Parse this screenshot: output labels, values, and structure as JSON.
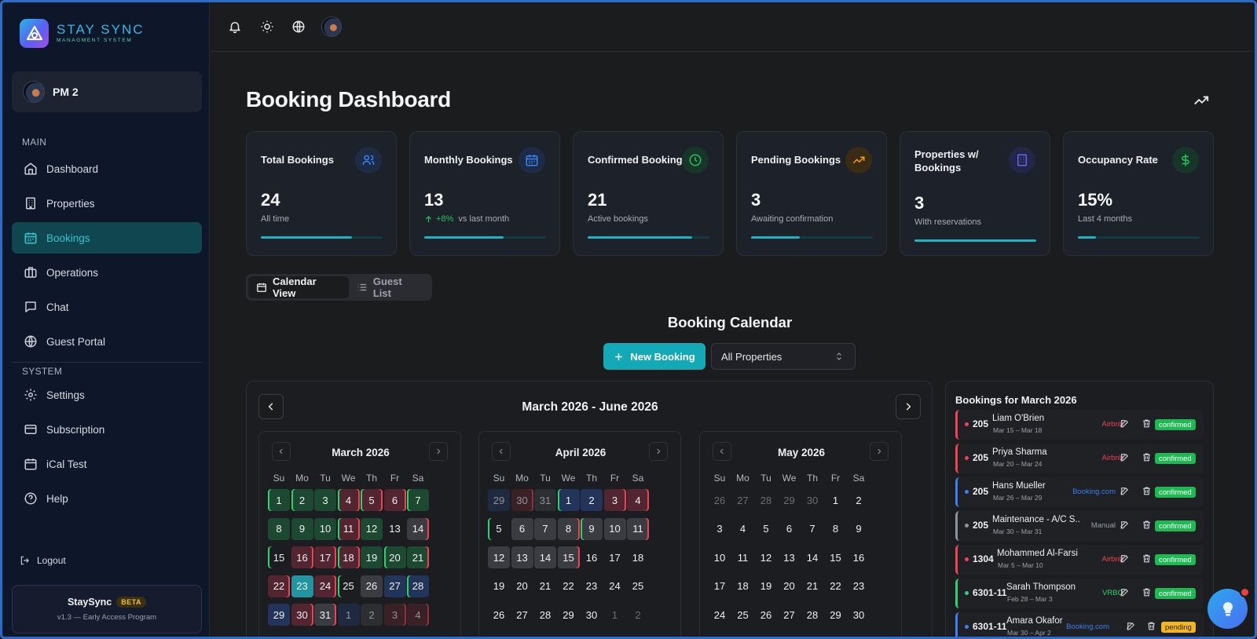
{
  "brand": {
    "title": "STAY SYNC",
    "subtitle": "MANAGMENT SYSTEM"
  },
  "user": {
    "name": "PM 2"
  },
  "sidebar": {
    "main_label": "MAIN",
    "system_label": "SYSTEM",
    "items": [
      {
        "label": "Dashboard",
        "icon": "home-icon"
      },
      {
        "label": "Properties",
        "icon": "building-icon"
      },
      {
        "label": "Bookings",
        "icon": "calendar-icon",
        "active": true
      },
      {
        "label": "Operations",
        "icon": "briefcase-icon"
      },
      {
        "label": "Chat",
        "icon": "chat-icon"
      },
      {
        "label": "Guest Portal",
        "icon": "globe-icon"
      },
      {
        "label": "Settings",
        "icon": "gear-icon"
      },
      {
        "label": "Subscription",
        "icon": "credit-card-icon"
      },
      {
        "label": "iCal Test",
        "icon": "calendar-icon"
      },
      {
        "label": "Help",
        "icon": "help-icon"
      }
    ],
    "logout": "Logout",
    "beta": {
      "name": "StaySync",
      "badge": "BETA",
      "sub": "v1.3 — Early Access Program"
    }
  },
  "page": {
    "title": "Booking Dashboard"
  },
  "stats": [
    {
      "title": "Total Bookings",
      "value": "24",
      "sub": "All time",
      "progress": 0.75,
      "icon": "users-icon",
      "accent": "#3b82f6"
    },
    {
      "title": "Monthly Bookings",
      "value": "13",
      "trend": "+8%",
      "sub": "vs last month",
      "progress": 0.65,
      "icon": "calendar-icon",
      "accent": "#3b82f6"
    },
    {
      "title": "Confirmed Bookings",
      "value": "21",
      "sub": "Active bookings",
      "progress": 0.86,
      "icon": "clock-icon",
      "accent": "#22c55e"
    },
    {
      "title": "Pending Bookings",
      "value": "3",
      "sub": "Awaiting confirmation",
      "progress": 0.4,
      "icon": "trending-up-icon",
      "accent": "#f59e0b"
    },
    {
      "title": "Properties w/ Bookings",
      "value": "3",
      "sub": "With reservations",
      "progress": 1.0,
      "icon": "building-icon",
      "accent": "#6366f1"
    },
    {
      "title": "Occupancy Rate",
      "value": "15%",
      "sub": "Last 4 months",
      "progress": 0.15,
      "icon": "dollar-icon",
      "accent": "#22c55e"
    }
  ],
  "tabs": {
    "calendar": "Calendar View",
    "guests": "Guest List"
  },
  "calendar": {
    "heading": "Booking Calendar",
    "new_booking": "New Booking",
    "property_select": "All Properties",
    "range": "March 2026 - June 2026",
    "dow": [
      "Su",
      "Mo",
      "Tu",
      "We",
      "Th",
      "Fr",
      "Sa"
    ],
    "months": [
      {
        "name": "March 2026",
        "weeks": [
          [
            "1",
            "2",
            "3",
            "4",
            "5",
            "6",
            "7"
          ],
          [
            "8",
            "9",
            "10",
            "11",
            "12",
            "13",
            "14"
          ],
          [
            "15",
            "16",
            "17",
            "18",
            "19",
            "20",
            "21"
          ],
          [
            "22",
            "23",
            "24",
            "25",
            "26",
            "27",
            "28"
          ],
          [
            "29",
            "30",
            "31",
            "1",
            "2",
            "3",
            "4"
          ]
        ],
        "styles": [
          [
            "g l",
            "g l",
            "g",
            "r l",
            "r l",
            "r r",
            "g l"
          ],
          [
            "g",
            "g",
            "g",
            "r l",
            "g",
            "x",
            "k r"
          ],
          [
            "x l",
            "r",
            "r r",
            "r l",
            "g",
            "g l",
            "g r"
          ],
          [
            "r",
            "t",
            "r r",
            "x l",
            "k",
            "b",
            "b l"
          ],
          [
            "b",
            "r",
            "k r",
            "b m",
            "k m",
            "r m",
            "r m"
          ]
        ]
      },
      {
        "name": "April 2026",
        "weeks": [
          [
            "29",
            "30",
            "31",
            "1",
            "2",
            "3",
            "4"
          ],
          [
            "5",
            "6",
            "7",
            "8",
            "9",
            "10",
            "11"
          ],
          [
            "12",
            "13",
            "14",
            "15",
            "16",
            "17",
            "18"
          ],
          [
            "19",
            "20",
            "21",
            "22",
            "23",
            "24",
            "25"
          ],
          [
            "26",
            "27",
            "28",
            "29",
            "30",
            "1",
            "2"
          ]
        ],
        "styles": [
          [
            "b m",
            "r m",
            "k m",
            "b l",
            "b",
            "r",
            "r r"
          ],
          [
            "x l",
            "k",
            "k",
            "k r",
            "k l",
            "k",
            "k r"
          ],
          [
            "k",
            "k",
            "k",
            "k r",
            "x",
            "x",
            "x"
          ],
          [
            "x",
            "x",
            "x",
            "x",
            "x",
            "x",
            "x"
          ],
          [
            "x",
            "x",
            "x",
            "x",
            "x",
            "x m",
            "x m"
          ]
        ]
      },
      {
        "name": "May 2026",
        "weeks": [
          [
            "26",
            "27",
            "28",
            "29",
            "30",
            "1",
            "2"
          ],
          [
            "3",
            "4",
            "5",
            "6",
            "7",
            "8",
            "9"
          ],
          [
            "10",
            "11",
            "12",
            "13",
            "14",
            "15",
            "16"
          ],
          [
            "17",
            "18",
            "19",
            "20",
            "21",
            "22",
            "23"
          ],
          [
            "24",
            "25",
            "26",
            "27",
            "28",
            "29",
            "30"
          ]
        ],
        "styles": [
          [
            "x m",
            "x m",
            "x m",
            "x m",
            "x m",
            "x",
            "x"
          ],
          [
            "x",
            "x",
            "x",
            "x",
            "x",
            "x",
            "x"
          ],
          [
            "x",
            "x",
            "x",
            "x",
            "x",
            "x",
            "x"
          ],
          [
            "x",
            "x",
            "x",
            "x",
            "x",
            "x",
            "x"
          ],
          [
            "x",
            "x",
            "x",
            "x",
            "x",
            "x",
            "x"
          ]
        ]
      }
    ]
  },
  "bookings": {
    "title": "Bookings for March 2026",
    "items": [
      {
        "unit": "205",
        "name": "Liam O'Brien",
        "dates": "Mar 15 – Mar 18",
        "source": "Airbnb",
        "status": "confirmed",
        "color": "#ef4255",
        "src_color": "#ef4255"
      },
      {
        "unit": "205",
        "name": "Priya Sharma",
        "dates": "Mar 20 – Mar 24",
        "source": "Airbnb",
        "status": "confirmed",
        "color": "#ef4255",
        "src_color": "#ef4255"
      },
      {
        "unit": "205",
        "name": "Hans Mueller",
        "dates": "Mar 26 – Mar 29",
        "source": "Booking.com",
        "status": "confirmed",
        "color": "#3b7ff2",
        "src_color": "#3b7ff2"
      },
      {
        "unit": "205",
        "name": "Maintenance - A/C S...",
        "dates": "Mar 30 – Mar 31",
        "source": "Manual",
        "status": "confirmed",
        "color": "#8e939b",
        "src_color": "#9aa0a9"
      },
      {
        "unit": "1304",
        "name": "Mohammed Al-Farsi",
        "dates": "Mar 5 – Mar 10",
        "source": "Airbnb",
        "status": "confirmed",
        "color": "#ef4255",
        "src_color": "#ef4255"
      },
      {
        "unit": "6301-11",
        "name": "Sarah Thompson",
        "dates": "Feb 28 – Mar 3",
        "source": "VRBO",
        "status": "confirmed",
        "color": "#2bd36e",
        "src_color": "#2bd36e"
      },
      {
        "unit": "6301-11",
        "name": "Amara Okafor",
        "dates": "Mar 30 – Apr 2",
        "source": "Booking.com",
        "status": "pending",
        "color": "#3b7ff2",
        "src_color": "#3b7ff2"
      }
    ]
  },
  "colors": {
    "accent": "#13a9b6",
    "confirmed": "#1fb954",
    "pending": "#f2b824"
  }
}
